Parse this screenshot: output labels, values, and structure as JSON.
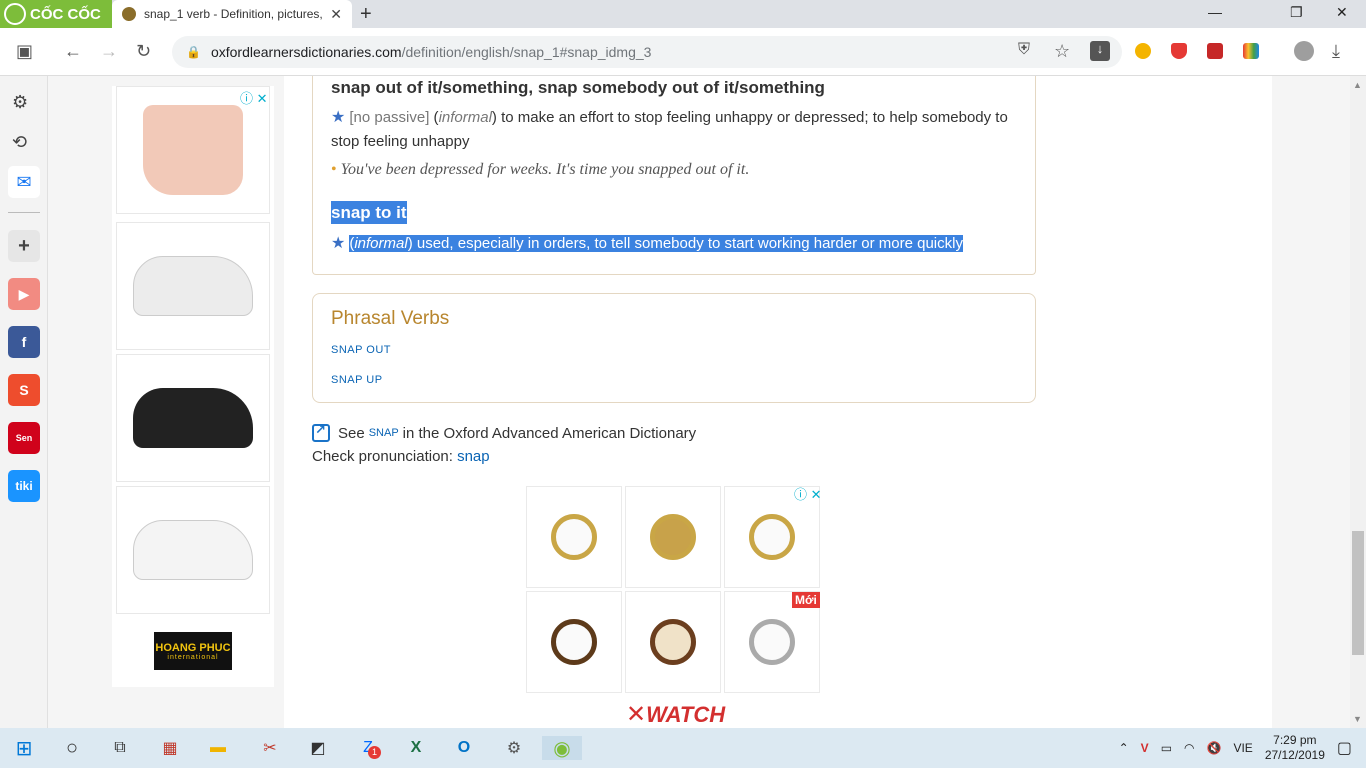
{
  "browser": {
    "brand": "CỐC CỐC",
    "tab_title": "snap_1 verb - Definition, pictures,",
    "url_host": "oxfordlearnersdictionaries.com",
    "url_path": "/definition/english/snap_1#snap_idmg_3"
  },
  "idioms": {
    "idiom1": "snap out of it/something, snap somebody out of it/something",
    "def1_gram": "[no passive]",
    "def1_label": "informal",
    "def1_text": "to make an effort to stop feeling unhappy or depressed; to help somebody to stop feeling unhappy",
    "example1": "You've been depressed for weeks. It's time you snapped out of it.",
    "idiom2": "snap to it",
    "def2_label": "informal",
    "def2_text": "used, especially in orders, to tell somebody to start working harder or more quickly"
  },
  "phrasal_verbs": {
    "title": "Phrasal Verbs",
    "items": [
      "snap out",
      "snap up"
    ]
  },
  "see_also": {
    "prefix": "See",
    "word": "snap",
    "suffix": "in the Oxford Advanced American Dictionary",
    "pron_label": "Check pronunciation:",
    "pron_word": "snap"
  },
  "ads": {
    "brand_name": "HOANG PHUC",
    "brand_sub": "international",
    "new_badge": "Mới",
    "watch_brand": "WATCH"
  },
  "taskbar": {
    "lang": "VIE",
    "time": "7:29 pm",
    "date": "27/12/2019",
    "zalo_badge": "1"
  },
  "colors": {
    "accent": "#3b82e0",
    "brand_green": "#7dbd3a",
    "oxford_gold": "#b8862e"
  }
}
